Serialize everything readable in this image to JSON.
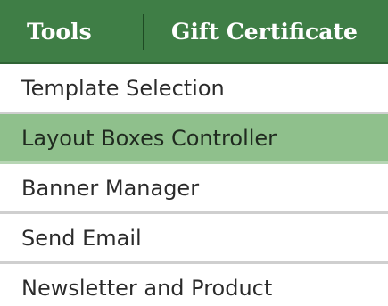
{
  "topbar": {
    "tabs": [
      {
        "label": "Tools"
      },
      {
        "label": "Gift Certificate"
      }
    ]
  },
  "menu": {
    "items": [
      {
        "label": "Template Selection",
        "active": false
      },
      {
        "label": "Layout Boxes Controller",
        "active": true
      },
      {
        "label": "Banner Manager",
        "active": false
      },
      {
        "label": "Send Email",
        "active": false
      },
      {
        "label": "Newsletter and Product",
        "active": false
      }
    ]
  },
  "colors": {
    "topbar_bg": "#3f7e46",
    "active_item_bg": "#8fc08c",
    "item_bg": "#ffffff"
  }
}
